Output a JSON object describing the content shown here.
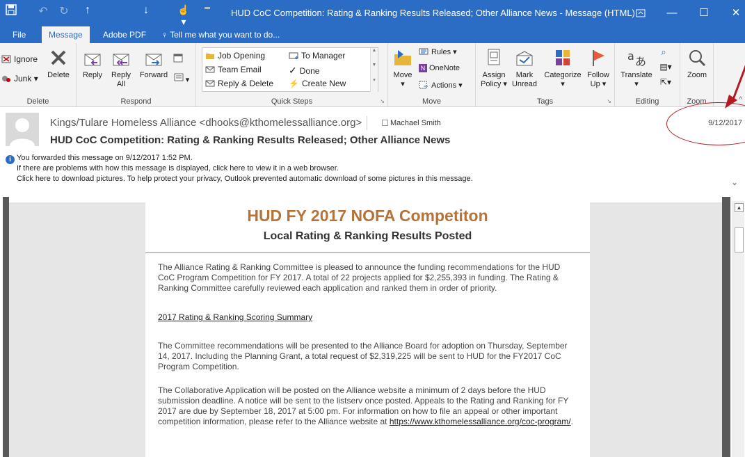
{
  "window": {
    "title": "HUD CoC Competition: Rating & Ranking Results Released; Other Alliance News - Message (HTML)"
  },
  "tabs": [
    {
      "label": "File"
    },
    {
      "label": "Message"
    },
    {
      "label": "Adobe PDF"
    },
    {
      "label": "Tell me what you want to do..."
    }
  ],
  "ribbon": {
    "delete_group": {
      "label": "Delete",
      "ignore": "Ignore",
      "junk": "Junk",
      "delete": "Delete"
    },
    "respond_group": {
      "label": "Respond",
      "reply": "Reply",
      "reply_all": "Reply All",
      "forward": "Forward"
    },
    "quick_steps": {
      "label": "Quick Steps",
      "items": [
        "Job Opening",
        "To Manager",
        "Team Email",
        "Done",
        "Reply & Delete",
        "Create New"
      ]
    },
    "move_group": {
      "label": "Move",
      "move": "Move",
      "rules": "Rules",
      "onenote": "OneNote",
      "actions": "Actions"
    },
    "tags_group": {
      "label": "Tags",
      "assign_policy": "Assign Policy",
      "mark_unread": "Mark Unread",
      "categorize": "Categorize",
      "follow_up": "Follow Up"
    },
    "editing_group": {
      "label": "Editing",
      "translate": "Translate"
    },
    "zoom_group": {
      "label": "Zoom",
      "zoom": "Zoom"
    }
  },
  "message": {
    "from": "Kings/Tulare Homeless Alliance <dhooks@kthomelessalliance.org>",
    "to": "Machael Smith",
    "date": "9/12/2017",
    "subject": "HUD CoC Competition: Rating & Ranking Results Released; Other Alliance News",
    "info_forwarded": "You forwarded this message on 9/12/2017 1:52 PM.",
    "info_problems": "If there are problems with how this message is displayed, click here to view it in a web browser.",
    "info_pictures": "Click here to download pictures. To help protect your privacy, Outlook prevented automatic download of some pictures in this message."
  },
  "body": {
    "heading": "HUD FY 2017 NOFA Competiton",
    "subheading": "Local Rating & Ranking Results Posted",
    "p1": "The Alliance Rating & Ranking Committee is pleased to announce the funding recommendations for the HUD CoC Program Competition for FY 2017.  A total of 22 projects applied for $2,255,393 in funding.  The Rating & Ranking Committee carefully reviewed each application and ranked them in order of priority.",
    "link_summary": "2017 Rating & Ranking Scoring Summary",
    "p2": "The Committee recommendations will be presented to the Alliance Board for adoption on Thursday, September 14, 2017.  Including the Planning Grant, a total request of $2,319,225 will be sent to HUD for the FY2017 CoC Program Competition.",
    "p3_text": "The Collaborative Application will be posted on the Alliance website a minimum of 2 days before the HUD submission deadline.  A notice will be sent to the listserv once posted.  Appeals to the Rating and Ranking for FY 2017 are due by September 18, 2017 at 5:00 pm.  For information on how to file an appeal or other important competition information, please refer to the Alliance website at ",
    "p3_link": "https://www.kthomelessalliance.org/coc-program/",
    "p3_end": "."
  },
  "colors": {
    "brand": "#2b6cc4",
    "heading": "#b5733a",
    "annotation": "#b01c22"
  }
}
